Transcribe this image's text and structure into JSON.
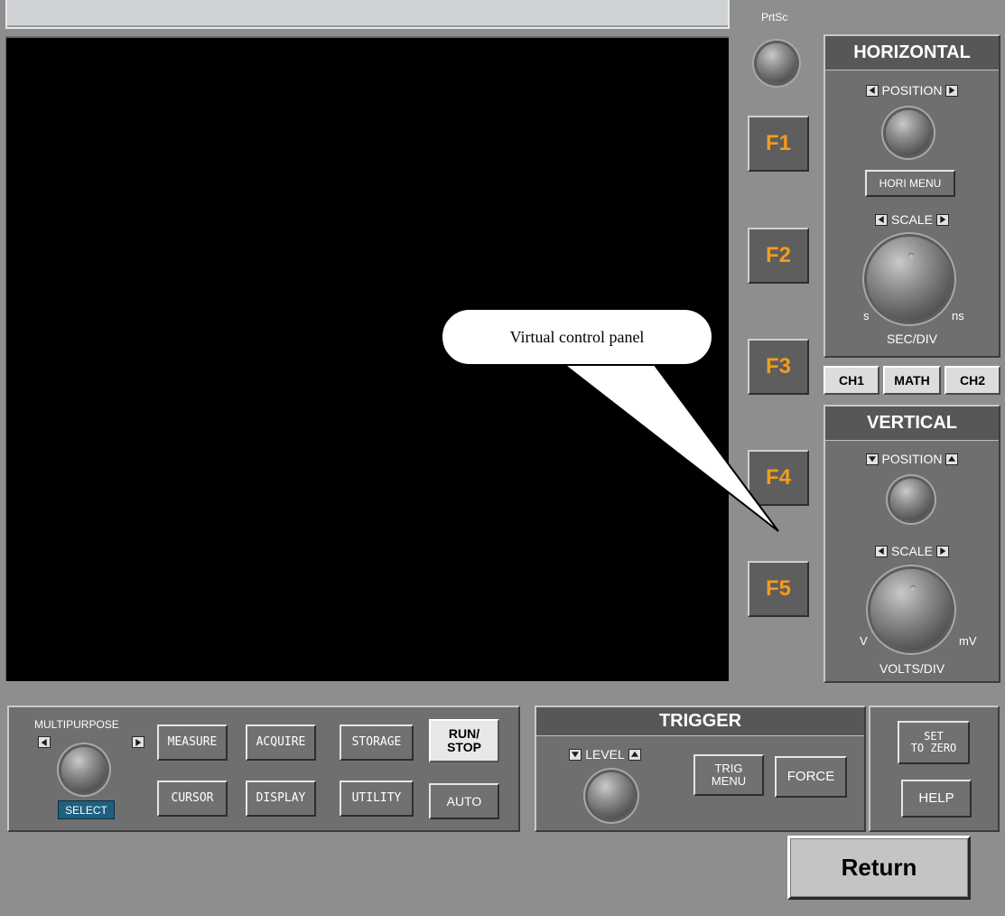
{
  "header": {
    "prtsc_label": "PrtSc"
  },
  "function_keys": [
    "F1",
    "F2",
    "F3",
    "F4",
    "F5"
  ],
  "callout": {
    "text": "Virtual control panel"
  },
  "horizontal": {
    "title": "HORIZONTAL",
    "position_label": "POSITION",
    "menu_button": "HORI MENU",
    "scale_label": "SCALE",
    "scale_left": "s",
    "scale_right": "ns",
    "scale_unit": "SEC/DIV"
  },
  "channels": {
    "ch1": "CH1",
    "math": "MATH",
    "ch2": "CH2"
  },
  "vertical": {
    "title": "VERTICAL",
    "position_label": "POSITION",
    "scale_label": "SCALE",
    "scale_left": "V",
    "scale_right": "mV",
    "scale_unit": "VOLTS/DIV"
  },
  "multipurpose": {
    "label": "MULTIPURPOSE",
    "select_label": "SELECT",
    "buttons": {
      "measure": "MEASURE",
      "acquire": "ACQUIRE",
      "storage": "STORAGE",
      "run_stop_1": "RUN/",
      "run_stop_2": "STOP",
      "cursor": "CURSOR",
      "display": "DISPLAY",
      "utility": "UTILITY",
      "auto": "AUTO"
    }
  },
  "trigger": {
    "title": "TRIGGER",
    "level_label": "LEVEL",
    "trig_menu_1": "TRIG",
    "trig_menu_2": "MENU",
    "force": "FORCE"
  },
  "side_buttons": {
    "set_zero_1": "SET",
    "set_zero_2": "TO ZERO",
    "help": "HELP"
  },
  "return_label": "Return"
}
